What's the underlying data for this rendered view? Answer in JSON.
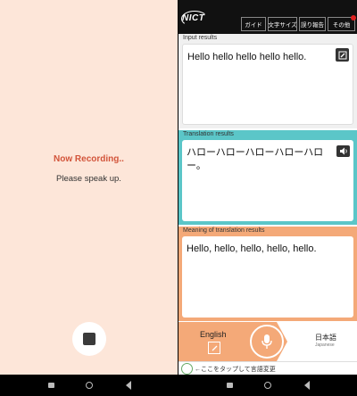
{
  "left": {
    "status": "Now Recording..",
    "prompt": "Please speak up."
  },
  "header": {
    "logo": "NICT",
    "buttons": [
      "ガイド",
      "文字サイズ",
      "誤り報告",
      "その他"
    ]
  },
  "input_panel": {
    "label": "Input results",
    "text": "Hello hello hello hello hello."
  },
  "translation_panel": {
    "label": "Translation results",
    "text": "ハローハローハローハローハロー。"
  },
  "meaning_panel": {
    "label": "Meaning of translation results",
    "text": "Hello, hello, hello, hello, hello."
  },
  "languages": {
    "source": "English",
    "target": "日本語",
    "target_sub": "Japanese"
  },
  "hint": "←ここをタップして言語変更",
  "colors": {
    "left_bg": "#fde6d9",
    "accent_orange": "#f4a978",
    "accent_teal": "#5bc6c8",
    "recording_red": "#d2543a"
  }
}
